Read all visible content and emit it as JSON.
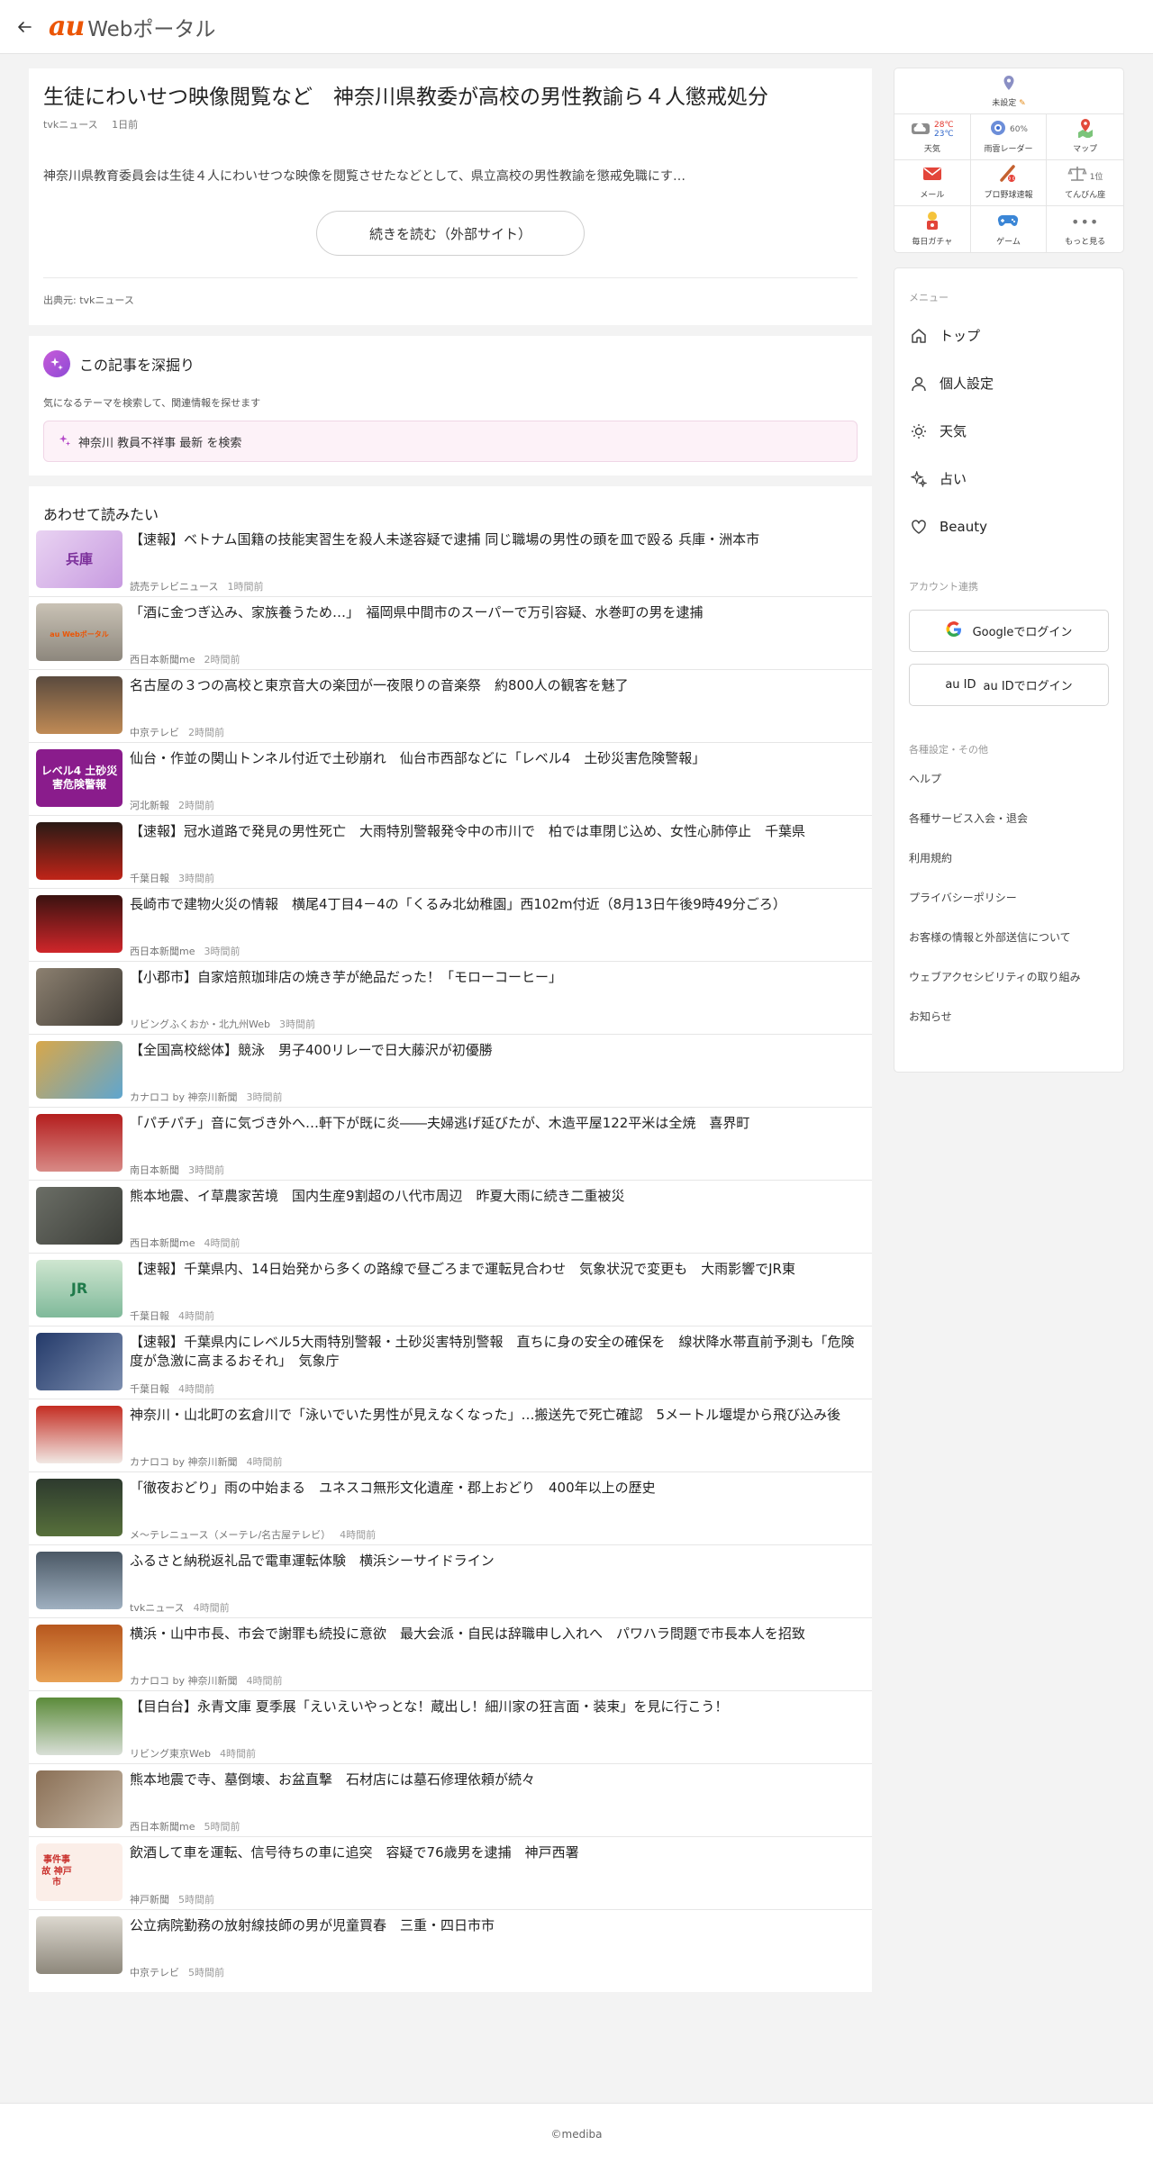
{
  "header": {
    "logo_au": "au",
    "logo_text": "Webポータル"
  },
  "article": {
    "title": "生徒にわいせつ映像閲覧など　神奈川県教委が高校の男性教諭ら４人懲戒処分",
    "source": "tvkニュース",
    "time": "1日前",
    "summary": "神奈川県教育委員会は生徒４人にわいせつな映像を閲覧させたなどとして、県立高校の男性教諭を懲戒免職にす…",
    "read_more": "続きを読む（外部サイト）",
    "credit": "出典元: tvkニュース"
  },
  "deep_dive": {
    "title": "この記事を深掘り",
    "subtitle": "気になるテーマを検索して、関連情報を探せます",
    "search_text": "神奈川 教員不祥事 最新 を検索"
  },
  "related": {
    "heading": "あわせて読みたい",
    "items": [
      {
        "title": "【速報】ベトナム国籍の技能実習生を殺人未遂容疑で逮捕 同じ職場の男性の頭を皿で殴る 兵庫・洲本市",
        "source": "読売テレビニュース",
        "time": "1時間前",
        "thumb_text": "兵庫"
      },
      {
        "title": "「酒に金つぎ込み、家族養うため…」　福岡県中間市のスーパーで万引容疑、水巻町の男を逮捕",
        "source": "西日本新聞me",
        "time": "2時間前",
        "thumb_text": "au Webポータル"
      },
      {
        "title": "名古屋の３つの高校と東京音大の楽団が一夜限りの音楽祭　約800人の観客を魅了",
        "source": "中京テレビ",
        "time": "2時間前",
        "thumb_text": ""
      },
      {
        "title": "仙台・作並の関山トンネル付近で土砂崩れ　仙台市西部などに「レベル4　土砂災害危険警報」",
        "source": "河北新報",
        "time": "2時間前",
        "thumb_text": "レベル4 土砂災害危険警報"
      },
      {
        "title": "【速報】冠水道路で発見の男性死亡　大雨特別警報発令中の市川で　柏では車閉じ込め、女性心肺停止　千葉県",
        "source": "千葉日報",
        "time": "3時間前",
        "thumb_text": ""
      },
      {
        "title": "長崎市で建物火災の情報　横尾4丁目4－4の「くるみ北幼稚園」西102m付近（8月13日午後9時49分ごろ）",
        "source": "西日本新聞me",
        "time": "3時間前",
        "thumb_text": ""
      },
      {
        "title": "【小郡市】自家焙煎珈琲店の焼き芋が絶品だった！「モローコーヒー」",
        "source": "リビングふくおか・北九州Web",
        "time": "3時間前",
        "thumb_text": ""
      },
      {
        "title": "【全国高校総体】競泳　男子400リレーで日大藤沢が初優勝",
        "source": "カナロコ by 神奈川新聞",
        "time": "3時間前",
        "thumb_text": ""
      },
      {
        "title": "「パチパチ」音に気づき外へ…軒下が既に炎――夫婦逃げ延びたが、木造平屋122平米は全焼　喜界町",
        "source": "南日本新聞",
        "time": "3時間前",
        "thumb_text": ""
      },
      {
        "title": "熊本地震、イ草農家苦境　国内生産9割超の八代市周辺　昨夏大雨に続き二重被災",
        "source": "西日本新聞me",
        "time": "4時間前",
        "thumb_text": ""
      },
      {
        "title": "【速報】千葉県内、14日始発から多くの路線で昼ごろまで運転見合わせ　気象状況で変更も　大雨影響でJR東",
        "source": "千葉日報",
        "time": "4時間前",
        "thumb_text": "JR"
      },
      {
        "title": "【速報】千葉県内にレベル5大雨特別警報・土砂災害特別警報　直ちに身の安全の確保を　線状降水帯直前予測も「危険度が急激に高まるおそれ」　気象庁",
        "source": "千葉日報",
        "time": "4時間前",
        "thumb_text": ""
      },
      {
        "title": "神奈川・山北町の玄倉川で「泳いでいた男性が見えなくなった」…搬送先で死亡確認　5メートル堰堤から飛び込み後",
        "source": "カナロコ by 神奈川新聞",
        "time": "4時間前",
        "thumb_text": ""
      },
      {
        "title": "「徹夜おどり」雨の中始まる　ユネスコ無形文化遺産・郡上おどり　400年以上の歴史",
        "source": "メ～テレニュース（メーテレ/名古屋テレビ）",
        "time": "4時間前",
        "thumb_text": ""
      },
      {
        "title": "ふるさと納税返礼品で電車運転体験　横浜シーサイドライン",
        "source": "tvkニュース",
        "time": "4時間前",
        "thumb_text": ""
      },
      {
        "title": "横浜・山中市長、市会で謝罪も続投に意欲　最大会派・自民は辞職申し入れへ　パワハラ問題で市長本人を招致",
        "source": "カナロコ by 神奈川新聞",
        "time": "4時間前",
        "thumb_text": ""
      },
      {
        "title": "【目白台】永青文庫 夏季展「えいえいやっとな！蔵出し！細川家の狂言面・装束」を見に行こう！",
        "source": "リビング東京Web",
        "time": "4時間前",
        "thumb_text": ""
      },
      {
        "title": "熊本地震で寺、墓倒壊、お盆直撃　石材店には墓石修理依頼が続々",
        "source": "西日本新聞me",
        "time": "5時間前",
        "thumb_text": ""
      },
      {
        "title": "飲酒して車を運転、信号待ちの車に追突　容疑で76歳男を逮捕　神戸西署",
        "source": "神戸新聞",
        "time": "5時間前",
        "thumb_text": "事件事故 神戸市"
      },
      {
        "title": "公立病院勤務の放射線技師の男が児童買春　三重・四日市市",
        "source": "中京テレビ",
        "time": "5時間前",
        "thumb_text": ""
      }
    ]
  },
  "sidebar": {
    "location_label": "未設定",
    "tiles": [
      {
        "label": "天気",
        "hi": "28℃",
        "lo": "23℃"
      },
      {
        "label": "雨雲レーダー",
        "note": "60%"
      },
      {
        "label": "マップ"
      },
      {
        "label": "メール"
      },
      {
        "label": "プロ野球速報"
      },
      {
        "label": "てんびん座",
        "note": "1位"
      },
      {
        "label": "毎日ガチャ"
      },
      {
        "label": "ゲーム"
      },
      {
        "label": "もっと見る"
      }
    ],
    "menu_heading": "メニュー",
    "menu_items": [
      "トップ",
      "個人設定",
      "天気",
      "占い",
      "Beauty"
    ],
    "account_heading": "アカウント連携",
    "google_login": "Googleでログイン",
    "au_id_label": "au ID",
    "au_login": "au IDでログイン",
    "other_heading": "各種設定・その他",
    "links": [
      "ヘルプ",
      "各種サービス入会・退会",
      "利用規約",
      "プライバシーポリシー",
      "お客様の情報と外部送信について",
      "ウェブアクセシビリティの取り組み",
      "お知らせ"
    ]
  },
  "footer": {
    "copyright": "©mediba"
  }
}
